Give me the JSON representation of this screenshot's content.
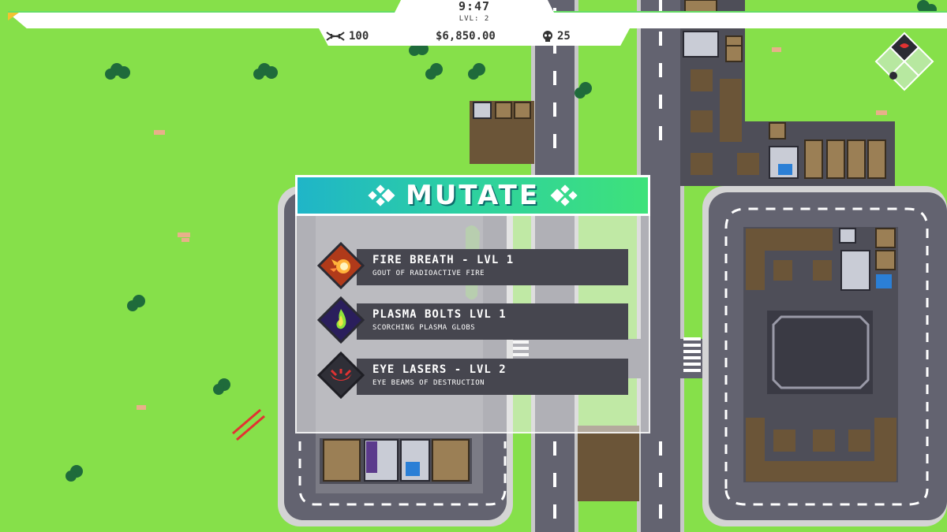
{
  "hud": {
    "timer": "9:47",
    "level": "LVL: 2",
    "dna_count": "100",
    "money": "$6,850.00",
    "kills": "25"
  },
  "mutate": {
    "title": "MUTATE",
    "options": [
      {
        "title": "FIRE BREATH - LVL 1",
        "description": "GOUT OF RADIOACTIVE FIRE",
        "icon": "fire-breath-icon",
        "color": "#b03a1a"
      },
      {
        "title": "PLASMA BOLTS LVL 1",
        "description": "SCORCHING PLASMA GLOBS",
        "icon": "plasma-bolt-icon",
        "color": "#2a1e5c"
      },
      {
        "title": "EYE LASERS - LVL 2",
        "description": "EYE BEAMS OF DESTRUCTION",
        "icon": "eye-laser-icon",
        "color": "#2f2f37"
      }
    ]
  },
  "colors": {
    "grass": "#86e04a",
    "road": "#636370",
    "sidewalk": "#d4d4d4",
    "dirt": "#6b5538",
    "accent_teal": "#1fb5c8",
    "accent_green": "#3ee27a"
  }
}
